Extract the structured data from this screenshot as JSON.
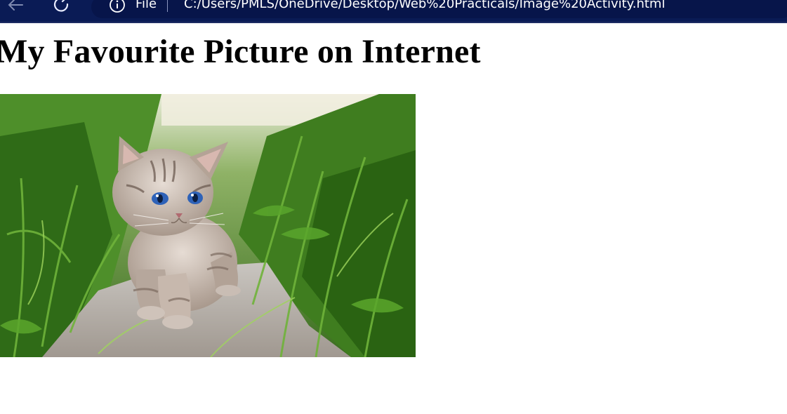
{
  "browser": {
    "scheme_label": "File",
    "url": "C:/Users/PMLS/OneDrive/Desktop/Web%20Practicals/Image%20Activity.html",
    "colors": {
      "toolbar": "#0a1b55",
      "address_box": "#07154a"
    }
  },
  "page": {
    "heading": "My Favourite Picture on Internet",
    "image": {
      "subject": "kitten",
      "icon": "photo"
    }
  }
}
